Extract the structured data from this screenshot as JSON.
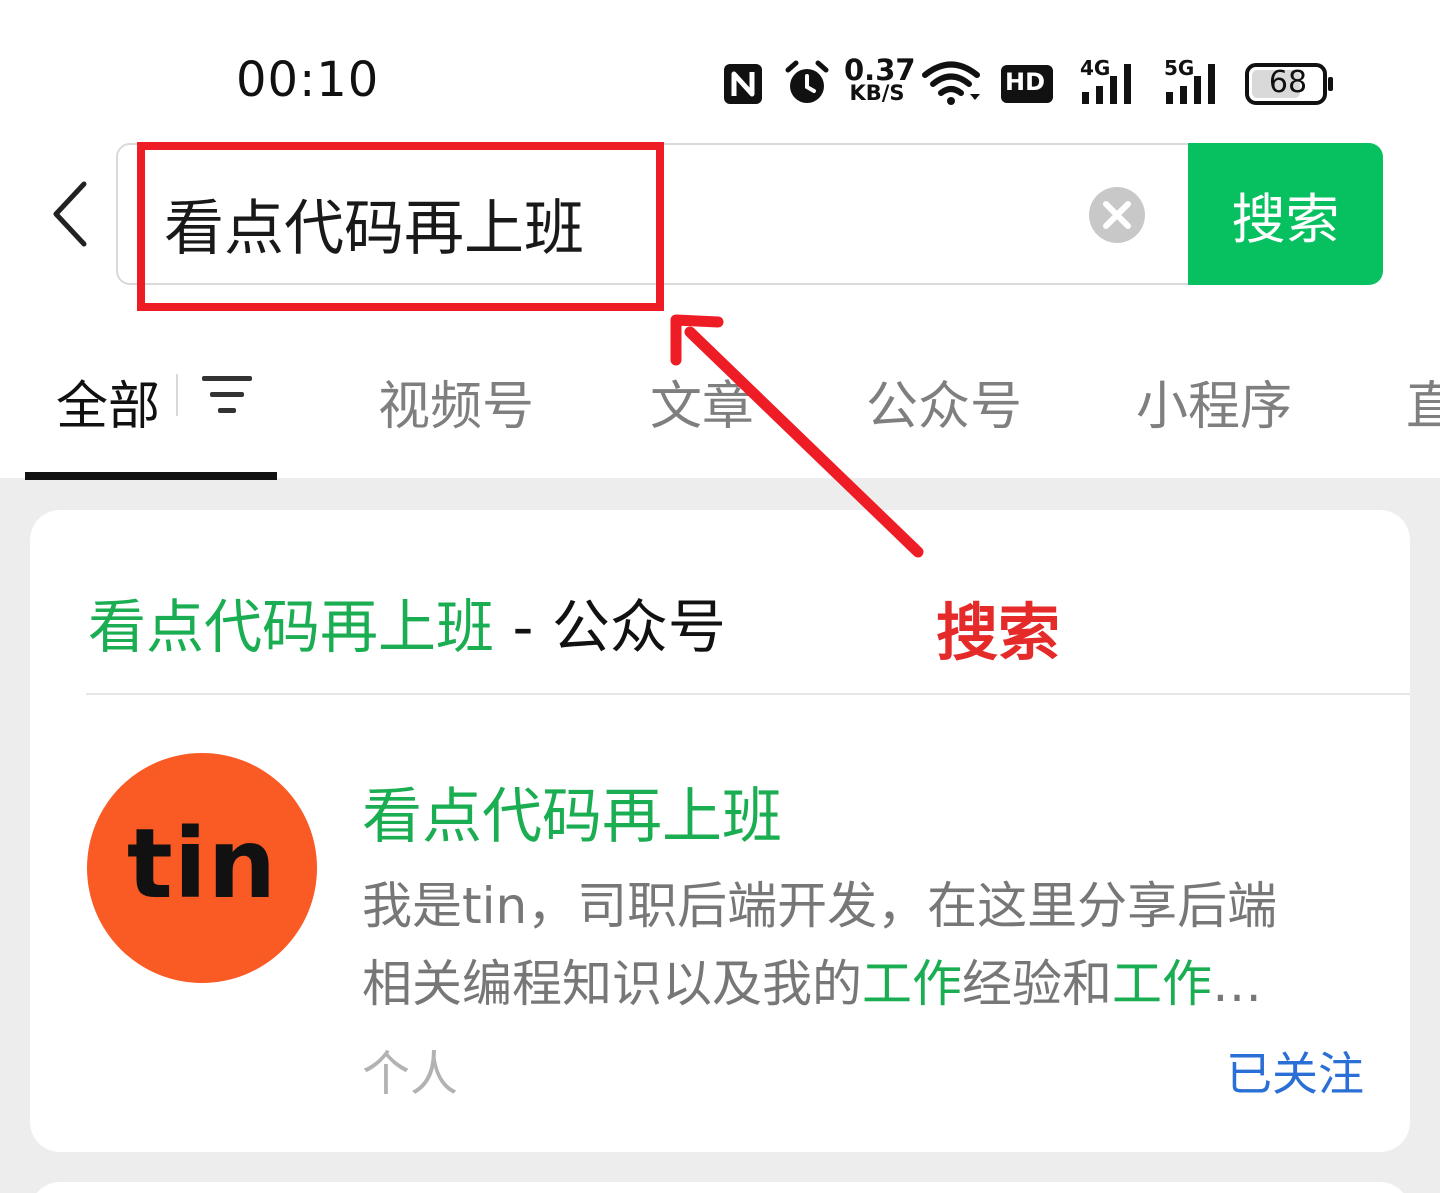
{
  "status_bar": {
    "time": "00:10",
    "net_speed_value": "0.37",
    "net_speed_unit": "KB/S",
    "hd_label": "HD",
    "network_4g": "4G",
    "network_5g": "5G",
    "battery": "68"
  },
  "search": {
    "query": "看点代码再上班",
    "button_label": "搜索"
  },
  "tabs": [
    {
      "label": "全部"
    },
    {
      "label": "视频号"
    },
    {
      "label": "文章"
    },
    {
      "label": "公众号"
    },
    {
      "label": "小程序"
    },
    {
      "label": "直"
    }
  ],
  "annotation": {
    "label": "搜索",
    "color": "#e52a2a"
  },
  "result_section": {
    "title_highlight": "看点代码再上班",
    "title_rest": " - 公众号"
  },
  "account": {
    "avatar_text": "tin",
    "name": "看点代码再上班",
    "desc_line1": "我是tin，司职后端开发，在这里分享后端",
    "desc_line2_a": "相关编程知识以及我的",
    "desc_line2_hl1": "工作",
    "desc_line2_b": "经验和",
    "desc_line2_hl2": "工作",
    "desc_line2_c": "…",
    "type": "个人",
    "follow_status": "已关注"
  },
  "colors": {
    "accent_green": "#07c160",
    "highlight_green": "#1aad52",
    "link_blue": "#2a6fd6",
    "annotation_red": "#ee1c25",
    "avatar_orange": "#fa5a24"
  }
}
